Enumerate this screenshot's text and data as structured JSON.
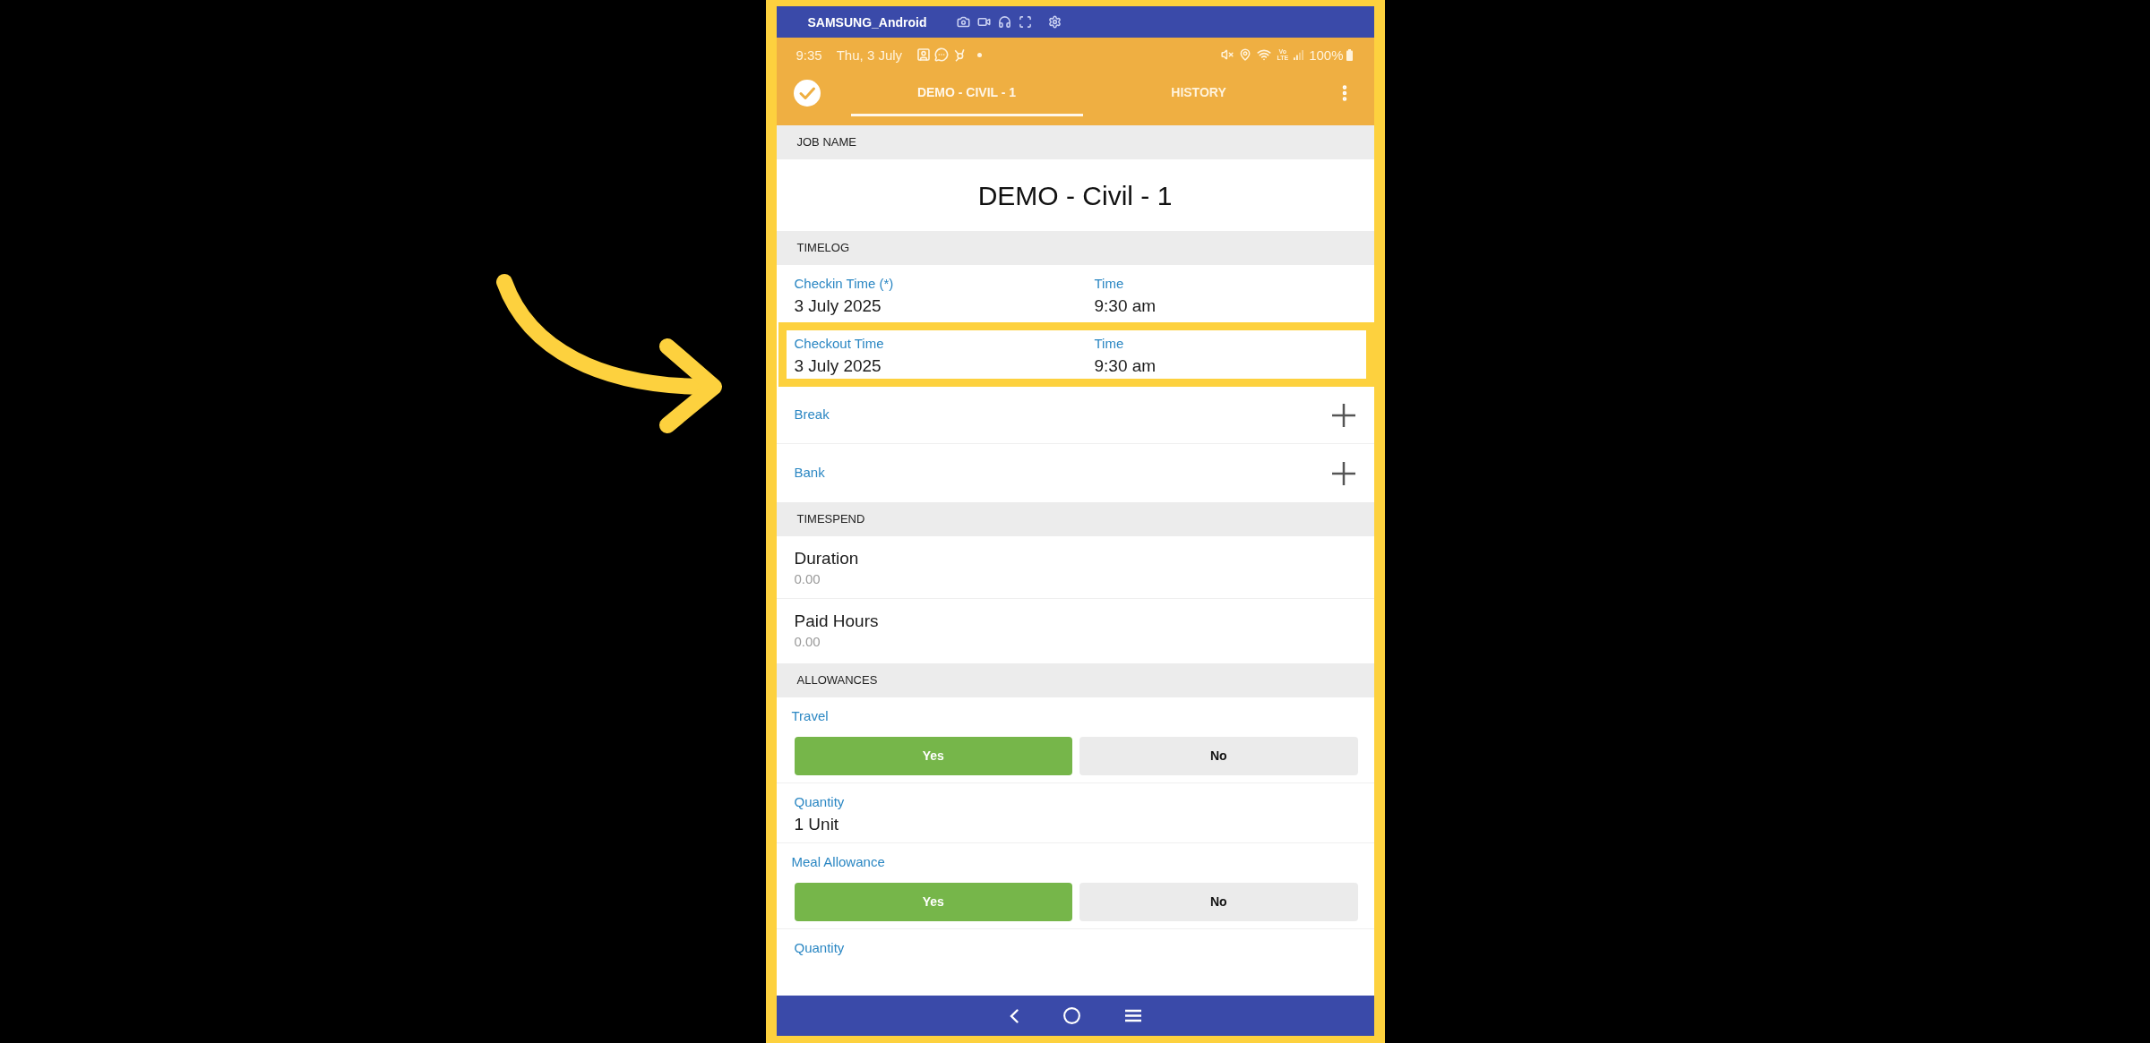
{
  "emulator_bar": {
    "title": "SAMSUNG_Android"
  },
  "status_bar": {
    "time": "9:35",
    "date": "Thu, 3 July",
    "network_type": {
      "top": "Vo",
      "bottom": "LTE"
    },
    "battery": "100%"
  },
  "app_bar": {
    "tabs": [
      {
        "label": "DEMO - CIVIL - 1",
        "selected": true
      },
      {
        "label": "HISTORY",
        "selected": false
      }
    ]
  },
  "sections": [
    {
      "header": "JOB NAME",
      "rows": [
        {
          "kind": "title",
          "value": "DEMO - Civil - 1"
        }
      ]
    },
    {
      "header": "TIMELOG",
      "rows": [
        {
          "kind": "datetime",
          "highlighted": false,
          "fields": [
            {
              "label": "Checkin Time (*)",
              "value": "3 July 2025"
            },
            {
              "label": "Time",
              "value": "9:30 am"
            }
          ]
        },
        {
          "kind": "datetime",
          "highlighted": true,
          "fields": [
            {
              "label": "Checkout Time",
              "value": "3 July 2025"
            },
            {
              "label": "Time",
              "value": "9:30 am"
            }
          ]
        },
        {
          "kind": "add",
          "label": "Break"
        },
        {
          "kind": "add",
          "label": "Bank"
        }
      ]
    },
    {
      "header": "TIMESPEND",
      "rows": [
        {
          "kind": "stat",
          "label": "Duration",
          "value": "0.00"
        },
        {
          "kind": "stat",
          "label": "Paid Hours",
          "value": "0.00"
        }
      ]
    },
    {
      "header": "ALLOWANCES",
      "rows": [
        {
          "kind": "choice",
          "label": "Travel",
          "options": [
            {
              "label": "Yes",
              "selected": true
            },
            {
              "label": "No",
              "selected": false
            }
          ]
        },
        {
          "kind": "quantity",
          "label": "Quantity",
          "value": "1 Unit"
        },
        {
          "kind": "choice",
          "label": "Meal Allowance",
          "options": [
            {
              "label": "Yes",
              "selected": true
            },
            {
              "label": "No",
              "selected": false
            }
          ]
        },
        {
          "kind": "quantity",
          "label": "Quantity"
        }
      ]
    }
  ]
}
